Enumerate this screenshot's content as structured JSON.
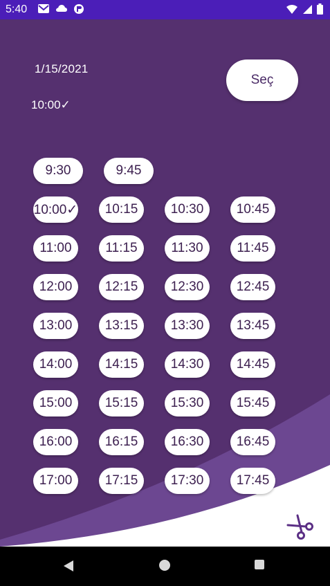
{
  "status_bar": {
    "time": "5:40",
    "left_icons": [
      "gmail-icon",
      "cloud-icon",
      "app-icon"
    ],
    "right_icons": [
      "wifi-icon",
      "signal-icon",
      "battery-icon"
    ]
  },
  "selection": {
    "date": "1/15/2021",
    "time": "10:00✓",
    "button_label": "Seç"
  },
  "slots": [
    [
      "9:30",
      "9:45"
    ],
    [
      "10:00✓",
      "10:15",
      "10:30",
      "10:45"
    ],
    [
      "11:00",
      "11:15",
      "11:30",
      "11:45"
    ],
    [
      "12:00",
      "12:15",
      "12:30",
      "12:45"
    ],
    [
      "13:00",
      "13:15",
      "13:30",
      "13:45"
    ],
    [
      "14:00",
      "14:15",
      "14:30",
      "14:45"
    ],
    [
      "15:00",
      "15:15",
      "15:30",
      "15:45"
    ],
    [
      "16:00",
      "16:15",
      "16:30",
      "16:45"
    ],
    [
      "17:00",
      "17:15",
      "17:30",
      "17:45"
    ]
  ],
  "footer": {
    "icon": "scissors-icon"
  },
  "nav_bar": {
    "icons": [
      "back-icon",
      "home-icon",
      "recents-icon"
    ]
  },
  "colors": {
    "background": "#55306f",
    "wave_light": "#6c4791",
    "status_bar": "#4b1eb8",
    "slot_text": "#3d2050",
    "accent": "#5b2f85"
  }
}
